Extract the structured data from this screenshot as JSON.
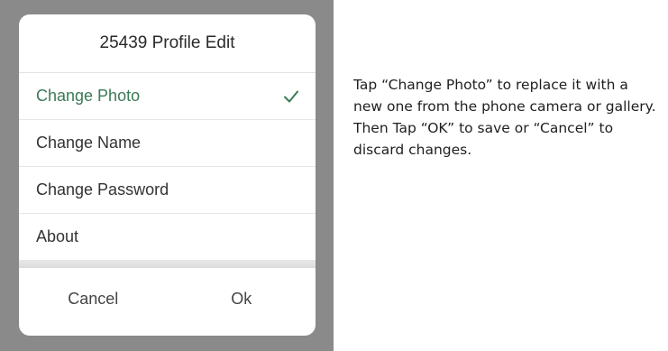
{
  "dialog": {
    "title": "25439 Profile Edit",
    "options": [
      {
        "label": "Change Photo",
        "selected": true
      },
      {
        "label": "Change Name",
        "selected": false
      },
      {
        "label": "Change Password",
        "selected": false
      },
      {
        "label": "About",
        "selected": false
      }
    ],
    "cancel_label": "Cancel",
    "ok_label": "Ok"
  },
  "help": {
    "text": "Tap “Change Photo” to replace it with a new one from the phone camera or gallery. Then Tap “OK” to save or “Cancel” to discard changes."
  },
  "colors": {
    "selected": "#3a7a55",
    "backdrop": "#8a8a8a"
  },
  "icons": {
    "selected_marker": "checkmark-icon"
  }
}
